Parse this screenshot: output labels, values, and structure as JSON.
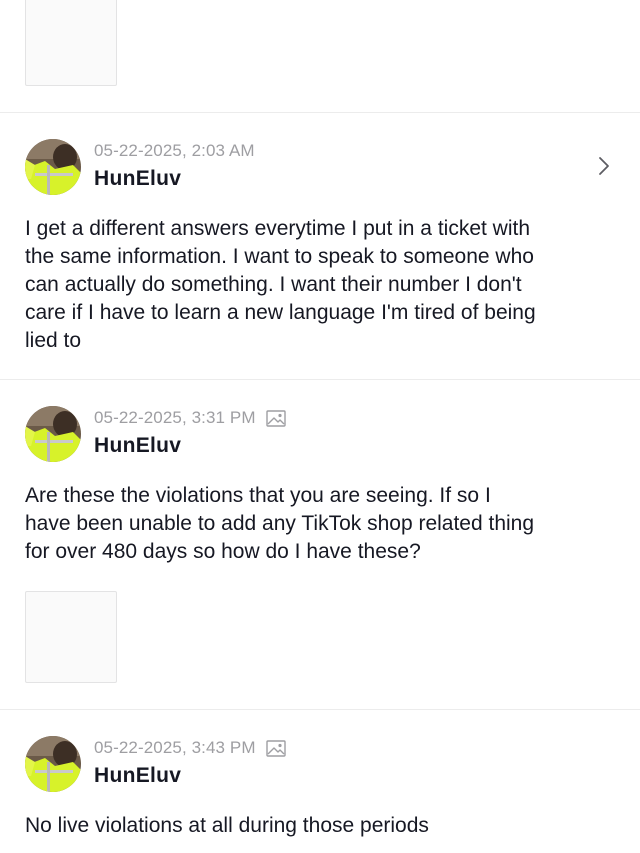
{
  "messages": [
    {
      "timestamp": "05-22-2025, 2:03 AM",
      "username": "HunEluv",
      "has_image_icon": false,
      "has_chevron": true,
      "text": "I get a different answers everytime I put in a ticket with\nthe same information. I want to speak to someone who\ncan actually do something. I want their number I don't\ncare if I have to learn a new language I'm tired of being\nlied to"
    },
    {
      "timestamp": "05-22-2025, 3:31 PM",
      "username": "HunEluv",
      "has_image_icon": true,
      "has_chevron": false,
      "text": "Are these the violations that you are seeing. If so I\nhave been unable to add any TikTok shop related thing\nfor over 480 days so how do I have these?"
    },
    {
      "timestamp": "05-22-2025, 3:43 PM",
      "username": "HunEluv",
      "has_image_icon": true,
      "has_chevron": false,
      "text": "No live violations at all during those periods"
    }
  ],
  "icons": {
    "avatar": "avatar-person-safety-vest",
    "image_attachment": "image-icon",
    "chevron": "chevron-right-icon"
  },
  "colors": {
    "timestamp": "#9e9ea2",
    "text": "#161823",
    "divider": "#ececec",
    "vest": "#d7f22a"
  }
}
